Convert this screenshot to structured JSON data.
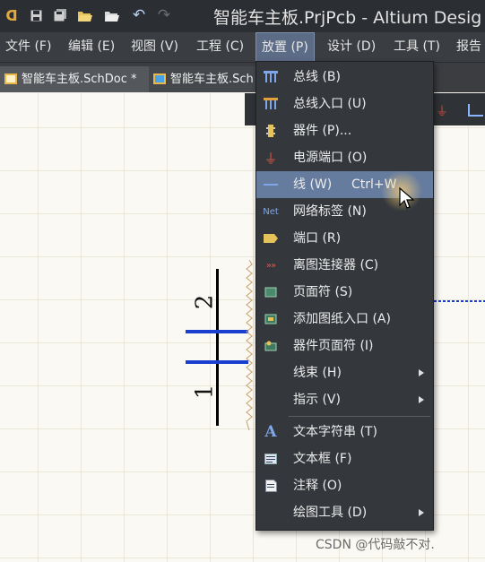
{
  "window": {
    "title": "智能车主板.PrjPcb - Altium Desig"
  },
  "menubar": {
    "items": [
      {
        "label": "文件 (F)"
      },
      {
        "label": "编辑 (E)"
      },
      {
        "label": "视图 (V)"
      },
      {
        "label": "工程 (C)"
      },
      {
        "label": "放置 (P)",
        "active": true
      },
      {
        "label": "设计 (D)"
      },
      {
        "label": "工具 (T)"
      },
      {
        "label": "报告"
      }
    ]
  },
  "tabs": [
    {
      "label": "智能车主板.SchDoc *",
      "active": true
    },
    {
      "label": "智能车主板.Sch"
    }
  ],
  "place_menu": {
    "items": [
      {
        "label": "总线 (B)",
        "icon": "bus-icon"
      },
      {
        "label": "总线入口 (U)",
        "icon": "bus-entry-icon"
      },
      {
        "label": "器件 (P)...",
        "icon": "part-icon"
      },
      {
        "label": "电源端口 (O)",
        "icon": "power-port-icon"
      },
      {
        "label": "线 (W)",
        "shortcut": "Ctrl+W",
        "icon": "wire-icon",
        "highlighted": true
      },
      {
        "label": "网络标签 (N)",
        "icon": "net-label-icon",
        "icon_text": "Net"
      },
      {
        "label": "端口 (R)",
        "icon": "port-icon"
      },
      {
        "label": "离图连接器 (C)",
        "icon": "off-sheet-connector-icon"
      },
      {
        "label": "页面符 (S)",
        "icon": "sheet-symbol-icon"
      },
      {
        "label": "添加图纸入口 (A)",
        "icon": "sheet-entry-icon"
      },
      {
        "label": "器件页面符 (I)",
        "icon": "device-sheet-symbol-icon"
      },
      {
        "label": "线束 (H)",
        "submenu": true
      },
      {
        "label": "指示 (V)",
        "submenu": true
      },
      {
        "label": "文本字符串 (T)",
        "icon": "text-string-icon",
        "icon_text": "A"
      },
      {
        "label": "文本框 (F)",
        "icon": "text-frame-icon"
      },
      {
        "label": "注释 (O)",
        "icon": "note-icon"
      },
      {
        "label": "绘图工具 (D)",
        "submenu": true
      }
    ]
  },
  "schematic": {
    "pins": [
      "1",
      "2"
    ]
  },
  "watermark": "CSDN @代码敲不对.",
  "colors": {
    "titlebar": "#2b2e33",
    "menu_bg": "#34373c",
    "highlight": "#667c9e",
    "wire": "#1a3fd0",
    "canvas": "#fbf9f3"
  }
}
